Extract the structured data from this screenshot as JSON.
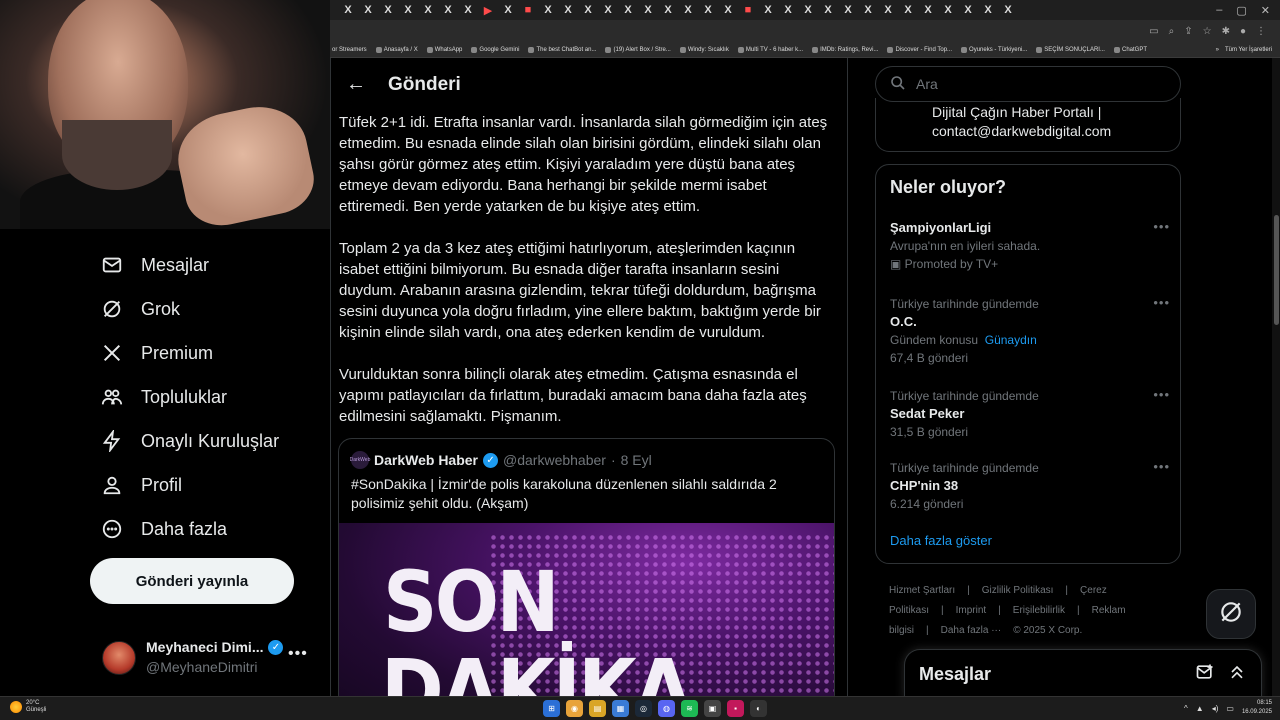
{
  "browser": {
    "tab_icons": [
      "X",
      "X",
      "X",
      "X",
      "X",
      "X",
      "X",
      "▶",
      "X",
      "■",
      "X",
      "X",
      "X",
      "X",
      "X",
      "X",
      "X",
      "X",
      "X",
      "X",
      "■",
      "X",
      "X",
      "X",
      "X",
      "X",
      "X",
      "X",
      "X",
      "X",
      "X",
      "X",
      "X",
      "X"
    ],
    "bookmarks": [
      "or Streamers",
      "Anasayfa / X",
      "WhatsApp",
      "Google Gemini",
      "The best ChatBot an...",
      "(19) Alert Box / Stre...",
      "Windy: Sıcaklık",
      "Multi TV - 6 haber k...",
      "IMDb: Ratings, Revi...",
      "Discover - Find Top...",
      "Oyuneks - Türkiyeni...",
      "SEÇİM SONUÇLARI...",
      "ChatGPT"
    ],
    "bookmarks_overflow": "»",
    "all_bookmarks": "Tüm Yer İşaretleri"
  },
  "nav": {
    "items": [
      {
        "label": "Mesajlar",
        "icon": "mail-icon"
      },
      {
        "label": "Grok",
        "icon": "grok-icon"
      },
      {
        "label": "Premium",
        "icon": "x-logo-icon"
      },
      {
        "label": "Topluluklar",
        "icon": "communities-icon"
      },
      {
        "label": "Onaylı Kuruluşlar",
        "icon": "lightning-icon"
      },
      {
        "label": "Profil",
        "icon": "profile-icon"
      },
      {
        "label": "Daha fazla",
        "icon": "more-circle-icon"
      }
    ],
    "post_button": "Gönderi yayınla",
    "profile": {
      "name": "Meyhaneci Dimi...",
      "handle": "@MeyhaneDimitri",
      "more": "•••"
    }
  },
  "main": {
    "back": "←",
    "title": "Gönderi",
    "paragraphs": [
      "Tüfek 2+1 idi. Etrafta insanlar vardı. İnsanlarda silah görmediğim için ateş etmedim. Bu esnada elinde silah olan birisini gördüm, elindeki silahı olan şahsı görür görmez ateş ettim. Kişiyi yaraladım yere düştü bana ateş etmeye devam ediyordu. Bana herhangi bir şekilde mermi isabet ettiremedi. Ben yerde yatarken de bu kişiye ateş ettim.",
      "Toplam 2 ya da 3 kez ateş ettiğimi hatırlıyorum, ateşlerimden kaçının isabet ettiğini bilmiyorum. Bu esnada diğer tarafta insanların sesini duydum. Arabanın arasına gizlendim, tekrar tüfeği doldurdum, bağrışma sesini duyunca yola doğru fırladım, yine ellere baktım, baktığım yerde bir kişinin elinde silah vardı, ona ateş ederken kendim de vuruldum.",
      "Vurulduktan sonra bilinçli olarak ateş etmedim. Çatışma esnasında el yapımı patlayıcıları da fırlattım, buradaki amacım bana daha fazla ateş edilmesini sağlamaktı. Pişmanım."
    ],
    "quote": {
      "logo_text": "DarkWeb",
      "name": "DarkWeb Haber",
      "handle": "@darkwebhaber",
      "sep": "·",
      "date": "8 Eyl",
      "text": "#SonDakika | İzmir'de polis karakoluna düzenlenen silahlı saldırıda 2 polisimiz şehit oldu. (Akşam)",
      "image_text_1": "SON",
      "image_text_2": "DAKİKA"
    }
  },
  "right": {
    "search_placeholder": "Ara",
    "prev_card_text": "Dijital Çağın Haber Portalı | contact@darkwebdigital.com",
    "trends_title": "Neler oluyor?",
    "trends": [
      {
        "category": "",
        "name": "ŞampiyonlarLigi",
        "desc": "Avrupa'nın en iyileri sahada.",
        "count": "Promoted by TV+"
      },
      {
        "category": "Türkiye tarihinde gündemde",
        "name": "O.C.",
        "desc": "Gündem konusu",
        "link": "Günaydın",
        "count": "67,4 B gönderi"
      },
      {
        "category": "Türkiye tarihinde gündemde",
        "name": "Sedat Peker",
        "count": "31,5 B gönderi"
      },
      {
        "category": "Türkiye tarihinde gündemde",
        "name": "CHP'nin 38",
        "count": "6.214 gönderi"
      }
    ],
    "show_more": "Daha fazla göster",
    "footer_links": [
      "Hizmet Şartları",
      "|",
      "Gizlilik Politikası",
      "|",
      "Çerez Politikası",
      "|",
      "Imprint",
      "|",
      "Erişilebilirlik",
      "|",
      "Reklam bilgisi",
      "|",
      "Daha fazla ···",
      "© 2025 X Corp."
    ],
    "messages_title": "Mesajlar"
  },
  "taskbar": {
    "temp": "20°C",
    "weather": "Güneşli",
    "time": "08:15",
    "date": "16.09.2025"
  },
  "colors": {
    "accent": "#1d9bf0",
    "background": "#000000",
    "border": "#2f3336",
    "muted": "#71767b"
  }
}
